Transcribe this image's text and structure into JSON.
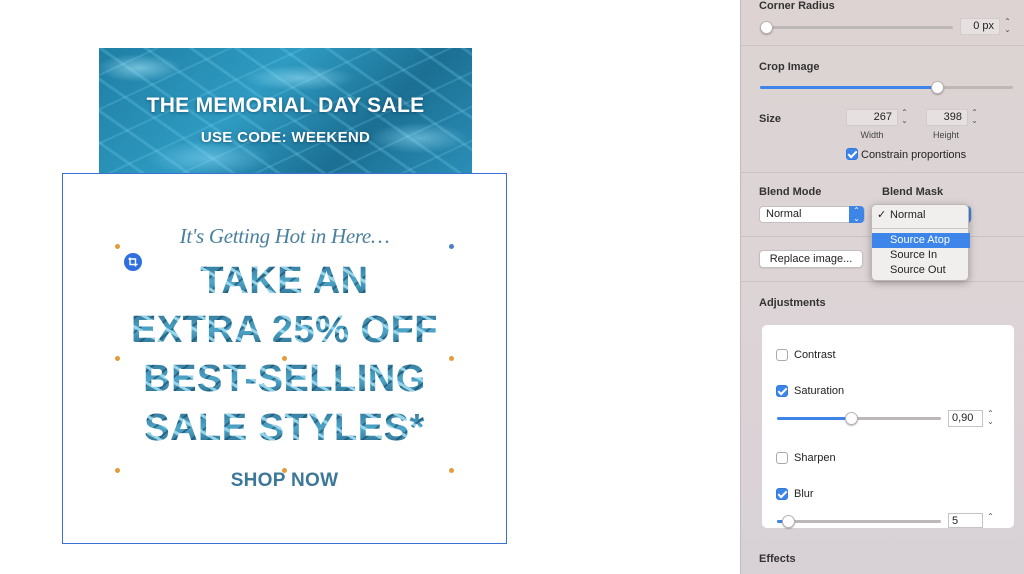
{
  "canvas": {
    "banner": {
      "title": "THE MEMORIAL DAY SALE",
      "code": "USE CODE: WEEKEND"
    },
    "card": {
      "tagline": "It's Getting Hot in Here…",
      "headline_lines": [
        "TAKE AN",
        "EXTRA 25% OFF",
        "BEST-SELLING",
        "SALE STYLES*"
      ],
      "cta": "SHOP NOW"
    }
  },
  "inspector": {
    "corner_radius": {
      "label": "Corner Radius",
      "value": "0 px",
      "level": 0.0
    },
    "crop_image": {
      "label": "Crop Image",
      "level": 0.7
    },
    "size": {
      "label": "Size",
      "width": "267",
      "width_label": "Width",
      "height": "398",
      "height_label": "Height",
      "constrain_label": "Constrain proportions",
      "constrain_checked": true
    },
    "blend": {
      "mode_label": "Blend Mode",
      "mode_value": "Normal",
      "mask_label": "Blend Mask",
      "mask_menu": {
        "items": [
          "Normal",
          "Source Atop",
          "Source In",
          "Source Out"
        ],
        "checked": "Normal",
        "highlighted": "Source Atop"
      }
    },
    "replace_button": "Replace image...",
    "adjustments": {
      "title": "Adjustments",
      "contrast": {
        "label": "Contrast",
        "checked": false
      },
      "saturation": {
        "label": "Saturation",
        "checked": true,
        "value": "0,90",
        "level": 0.45
      },
      "sharpen": {
        "label": "Sharpen",
        "checked": false
      },
      "blur": {
        "label": "Blur",
        "checked": true,
        "value": "5",
        "level": 0.05
      }
    },
    "effects_title": "Effects"
  },
  "colors": {
    "accent": "#3d85e8",
    "selection_border": "#3a6fd3",
    "handle": "#e39b3c",
    "sidebar_bg": "#dcd3d2"
  },
  "icons": {
    "crop": "crop-icon",
    "stepper": "stepper-icon",
    "popup_arrow": "popup-arrow-icon"
  }
}
